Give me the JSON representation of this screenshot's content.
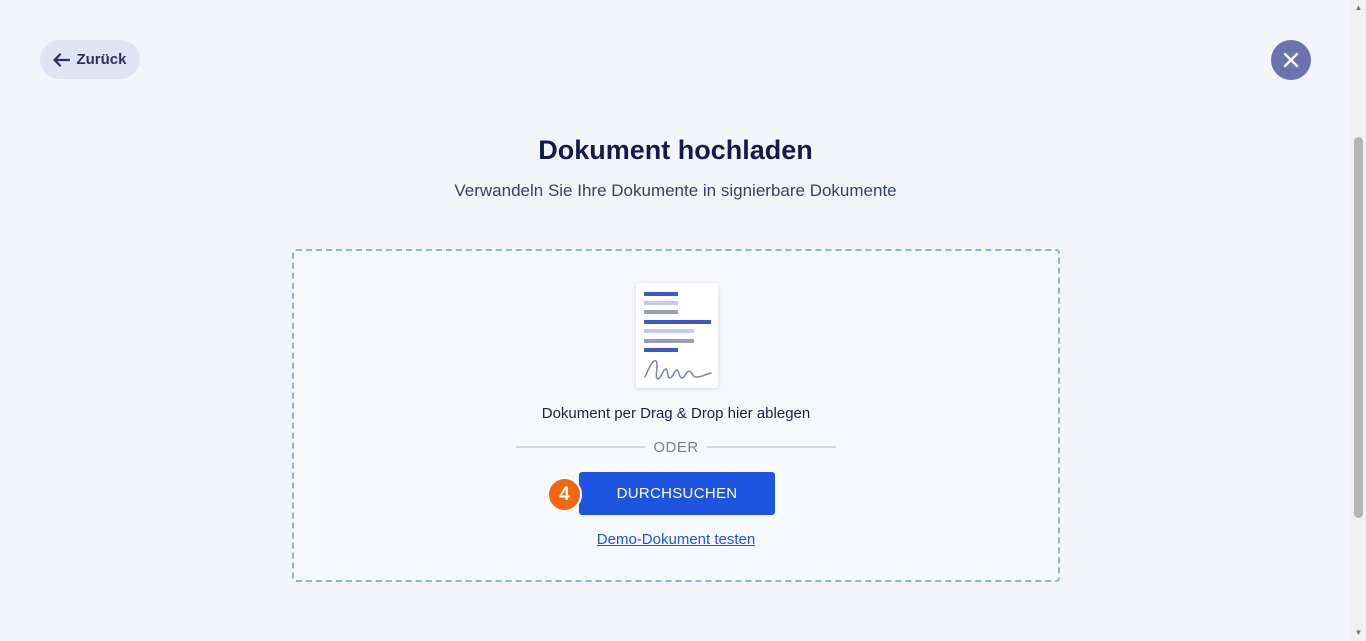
{
  "header": {
    "back_label": "Zurück",
    "back_icon": "arrow-left-icon",
    "close_icon": "close-icon"
  },
  "page": {
    "title": "Dokument hochladen",
    "subtitle": "Verwandeln Sie Ihre Dokumente in signierbare Dokumente"
  },
  "dropzone": {
    "illustration_icon": "signed-document-icon",
    "drop_text": "Dokument per Drag & Drop hier ablegen",
    "or_label": "ODER",
    "browse_label": "DURCHSUCHEN",
    "step_number": "4",
    "demo_link": "Demo-Dokument testen"
  },
  "colors": {
    "primary": "#1d54e0",
    "badge": "#f2670f",
    "close_button": "#6b72b0",
    "back_button_bg": "#dfe3f3",
    "dropzone_border": "#8fb0ea"
  }
}
